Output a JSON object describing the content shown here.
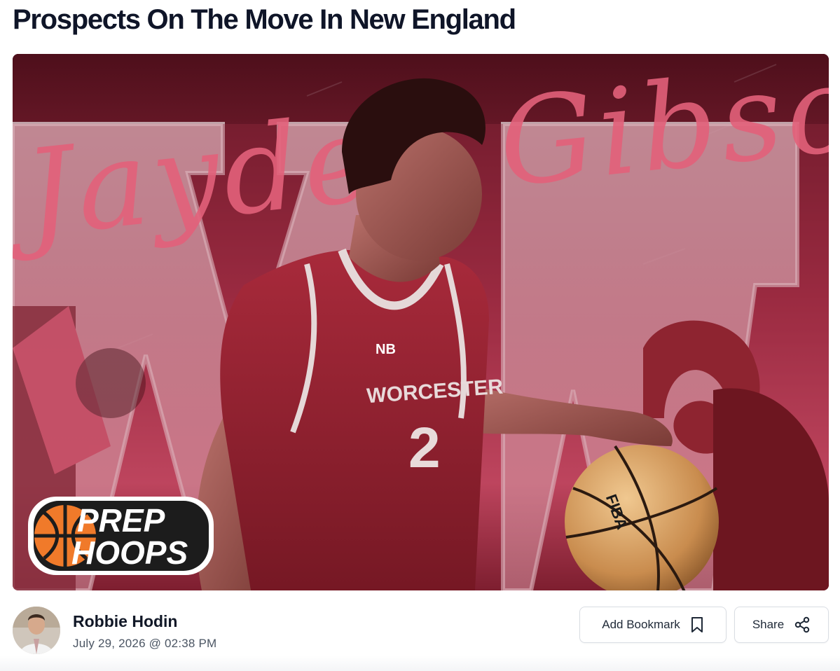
{
  "article": {
    "title": "Prospects On The Move In New England"
  },
  "hero": {
    "player_name_script": "Jayden Gibson",
    "jersey_text": "WORCESTER",
    "jersey_number": "2",
    "ball_text": "FIBA",
    "logo_line1": "PREP",
    "logo_line2": "HOOPS",
    "colors": {
      "primary": "#8e2236",
      "accent": "#e0607a",
      "jersey": "#8f1f2e"
    }
  },
  "author": {
    "name": "Robbie Hodin",
    "date": "July 29, 2026 @ 02:38 PM"
  },
  "actions": {
    "bookmark_label": "Add Bookmark",
    "bookmark_icon": "bookmark-icon",
    "share_label": "Share",
    "share_icon": "share-icon"
  }
}
